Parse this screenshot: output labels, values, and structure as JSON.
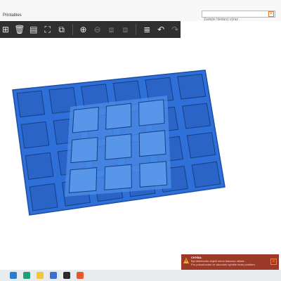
{
  "window": {
    "title": "Printables"
  },
  "search": {
    "placeholder": "Zadejte hledaný výraz",
    "close_icon": "close-icon"
  },
  "toolbar": {
    "items": [
      {
        "name": "add-object-icon",
        "glyph": "⊞",
        "enabled": true
      },
      {
        "name": "delete-icon",
        "glyph": "🗑",
        "enabled": true
      },
      {
        "name": "delete-all-icon",
        "glyph": "▤",
        "enabled": true
      },
      {
        "name": "arrange-icon",
        "glyph": "⛶",
        "enabled": true
      },
      {
        "name": "copy-icon",
        "glyph": "⧉",
        "enabled": true
      },
      {
        "name": "add-instance-icon",
        "glyph": "⊕",
        "enabled": true
      },
      {
        "name": "remove-instance-icon",
        "glyph": "⊖",
        "enabled": false
      },
      {
        "name": "split-objects-icon",
        "glyph": "⧈",
        "enabled": false
      },
      {
        "name": "split-parts-icon",
        "glyph": "⧈",
        "enabled": false
      },
      {
        "name": "layers-editing-icon",
        "glyph": "≣",
        "enabled": true
      },
      {
        "name": "undo-icon",
        "glyph": "↶",
        "enabled": true
      },
      {
        "name": "redo-icon",
        "glyph": "↷",
        "enabled": false
      }
    ]
  },
  "notification": {
    "title": "CHYBA:",
    "line1": "Byl detekován objekt mimo tiskovou oblast.",
    "line2": "Pro pokračování ve slicování vyřešte tento problém.",
    "severity_color": "#9c3a2a"
  },
  "colors": {
    "model": "#2f6fd8",
    "model_dark": "#1a4fa8",
    "overlay": "#4d8fe8"
  },
  "taskbar": {
    "apps": [
      {
        "name": "start-icon",
        "color": "#2b7bd3"
      },
      {
        "name": "edge-icon",
        "color": "#1f9e7a"
      },
      {
        "name": "explorer-icon",
        "color": "#f2c53d"
      },
      {
        "name": "store-icon",
        "color": "#3c6fd1"
      },
      {
        "name": "app-icon",
        "color": "#2a2a2a"
      },
      {
        "name": "prusa-slicer-icon",
        "color": "#e8562a"
      }
    ]
  }
}
